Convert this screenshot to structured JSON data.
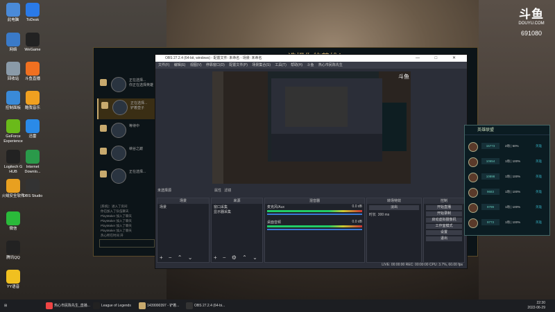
{
  "desktop_icons": [
    {
      "label": "此电脑",
      "color": "#4a8ad8"
    },
    {
      "label": "网络",
      "color": "#3a7ac8"
    },
    {
      "label": "回收站",
      "color": "#8a9aa8"
    },
    {
      "label": "控制面板",
      "color": "#3a8ad8"
    },
    {
      "label": "GeForce Experience",
      "color": "#6aba1a"
    },
    {
      "label": "Logitech G HUB",
      "color": "#222"
    },
    {
      "label": "火绒安全软件",
      "color": "#e8a020"
    },
    {
      "label": "微信",
      "color": "#2aba3a"
    },
    {
      "label": "腾讯QQ",
      "color": "#222"
    },
    {
      "label": "YY语音",
      "color": "#f0c020"
    },
    {
      "label": "ToDesk",
      "color": "#2a7ae8"
    },
    {
      "label": "WeGame",
      "color": "#222"
    },
    {
      "label": "斗鱼直播",
      "color": "#f07020"
    },
    {
      "label": "酷我音乐",
      "color": "#f0a020"
    },
    {
      "label": "迅雷",
      "color": "#2a8ae8"
    },
    {
      "label": "Internet Downlo...",
      "color": "#2a9a4a"
    },
    {
      "label": "OBS Studio",
      "color": "#333"
    }
  ],
  "douyu": {
    "mark": "斗鱼",
    "url": "DOUYU.COM",
    "room": "691080"
  },
  "lol": {
    "title": "选择你的英雄！",
    "picks": [
      {
        "status": "正在选择...",
        "sub": "你正在选择英雄"
      },
      {
        "status": "正在选择...",
        "sub": "铲着壶子",
        "highlight": true
      },
      {
        "status": "",
        "sub": "等待中"
      },
      {
        "status": "",
        "sub": "峡谷之巅"
      },
      {
        "status": "",
        "sub": "正在选择..."
      }
    ],
    "chat": [
      "[系统]：进入了房间",
      "你已加入了队伍聊天",
      "PlayMaker 加入了聊天",
      "PlayMaker 加入了聊天",
      "PlayMaker 加入了聊天",
      "PlayMaker 加入了聊天",
      "热心所在时间 开"
    ]
  },
  "obs": {
    "title": "OBS 27.2.4 (64-bit, windows) - 配置文件: 未命名 - 场景: 未命名",
    "window_buttons": "— □ ✕",
    "menu": [
      "文件(F)",
      "编辑(E)",
      "视图(V)",
      "停靠窗口(D)",
      "配置文件(P)",
      "场景集合(S)",
      "工具(T)",
      "帮助(H)",
      "斗鱼 热心市民陈先生"
    ],
    "no_source": "未选择源",
    "tabs": [
      "属性",
      "滤镜"
    ],
    "docks": {
      "scenes": {
        "title": "场景",
        "items": [
          "场景"
        ]
      },
      "sources": {
        "title": "来源",
        "items": [
          "窗口采集",
          "显示器采集"
        ]
      },
      "mixer": {
        "title": "混音器",
        "tracks": [
          {
            "name": "麦克风/Aux",
            "db": "0.0 dB"
          },
          {
            "name": "桌面音频",
            "db": "0.0 dB"
          }
        ]
      },
      "transitions": {
        "title": "转场特效",
        "type": "淡出",
        "duration_label": "时长",
        "duration": "300 ms"
      },
      "controls": {
        "title": "控制",
        "buttons": [
          "开始直播",
          "开始录制",
          "启动虚拟摄像机",
          "工作室模式",
          "设置",
          "退出"
        ]
      }
    },
    "status": "LIVE: 00:00:00   REC: 00:00:00   CPU: 3.7%, 60.00 fps"
  },
  "friends": {
    "title": "英雄联盟",
    "rows": [
      {
        "num": "15773",
        "stat": "2场 | 50%",
        "link": "英雄"
      },
      {
        "num": "10654",
        "stat": "1场 | 100%",
        "link": "英雄"
      },
      {
        "num": "10898",
        "stat": "1场 | 100%",
        "link": "英雄"
      },
      {
        "num": "9683",
        "stat": "1场 | 100%",
        "link": "英雄"
      },
      {
        "num": "9799",
        "stat": "1场 | 100%",
        "link": "英雄"
      },
      {
        "num": "9773",
        "stat": "1场 | 100%",
        "link": "英雄"
      }
    ]
  },
  "taskbar": {
    "items": [
      {
        "label": "热心市民陈先生_直播...",
        "color": "#e44"
      },
      {
        "label": "League of Legends",
        "color": "#222"
      },
      {
        "label": "1439990397 - 铲着...",
        "color": "#c8aa6e"
      },
      {
        "label": "OBS 27.2.4 (64-bi...",
        "color": "#333"
      }
    ],
    "time": "22:30",
    "date": "2022-06-29"
  }
}
